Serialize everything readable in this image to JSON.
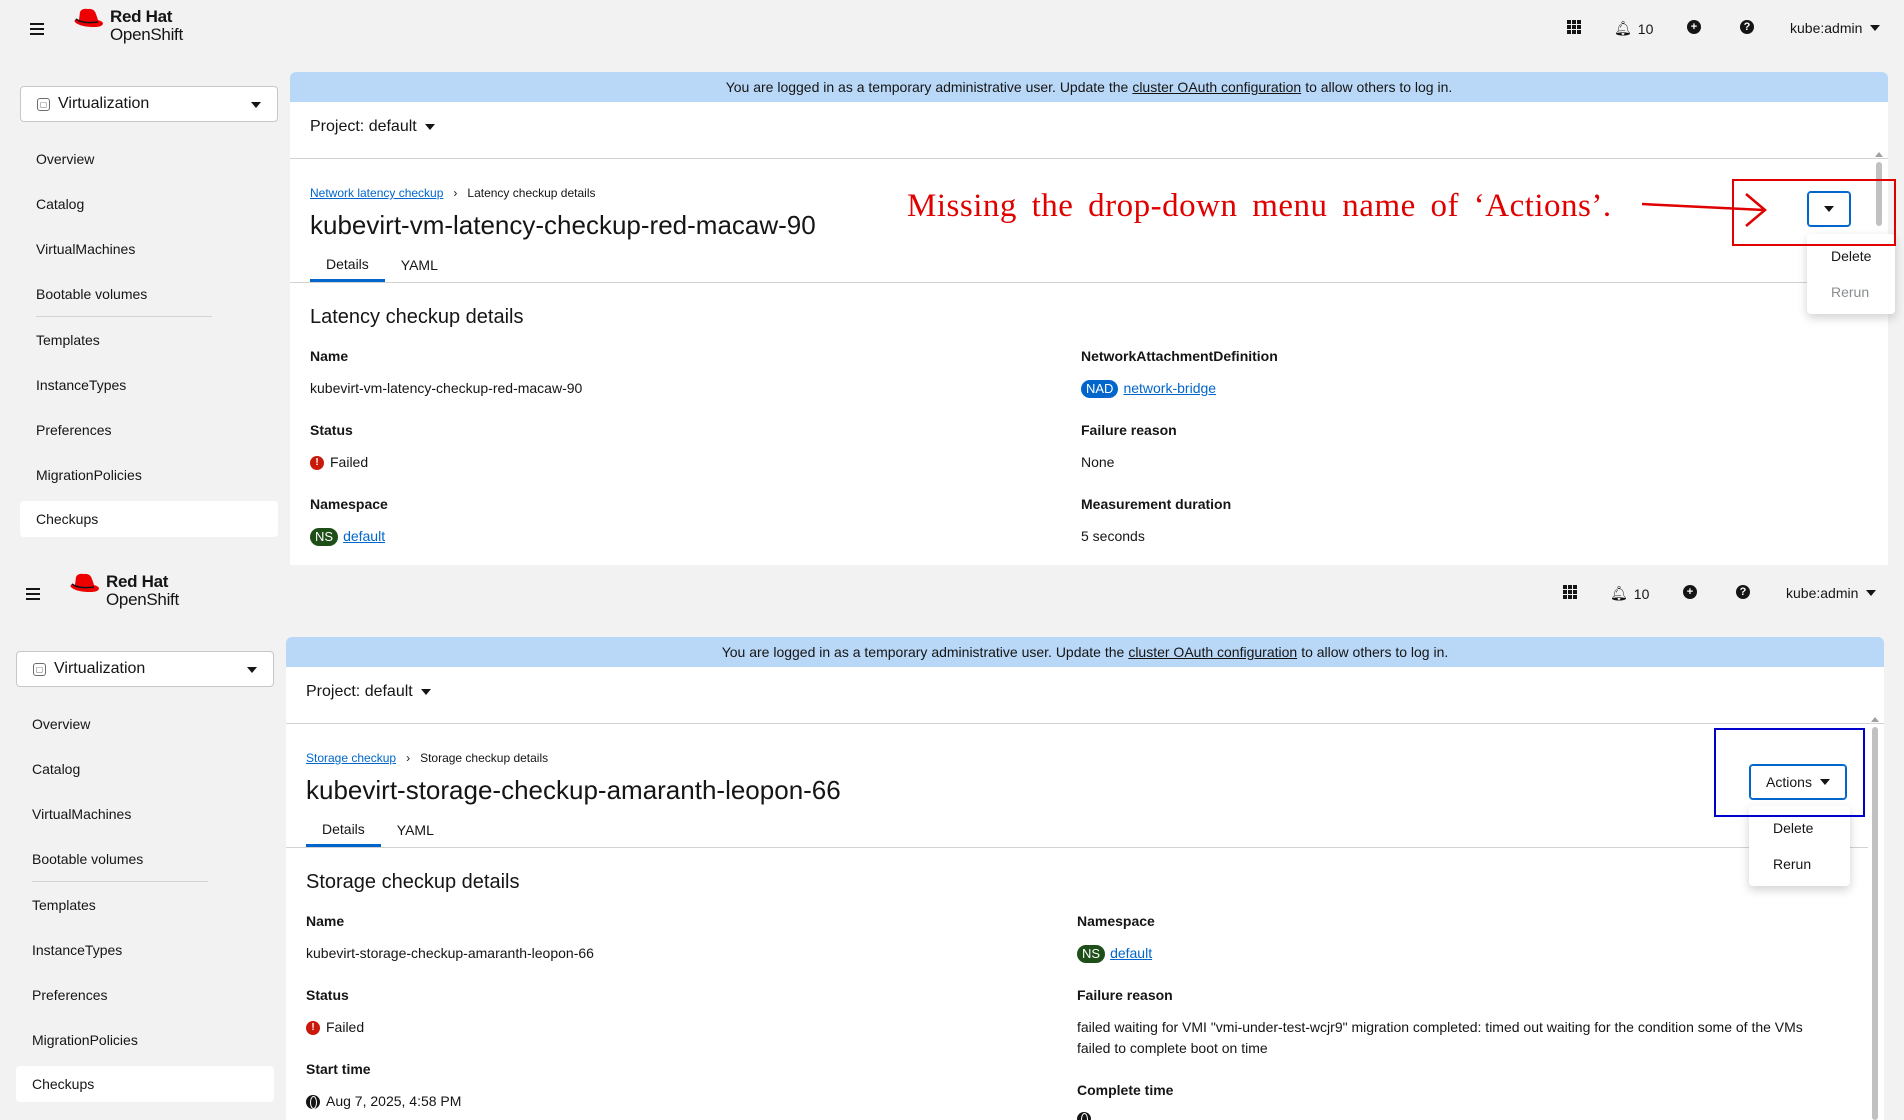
{
  "masthead": {
    "brand_line1": "Red Hat",
    "brand_line2": "OpenShift",
    "notifications_count": "10",
    "add_symbol": "+",
    "help_symbol": "?",
    "user": "kube:admin"
  },
  "sidebar": {
    "perspective": "Virtualization",
    "items": [
      "Overview",
      "Catalog",
      "VirtualMachines",
      "Bootable volumes",
      "Templates",
      "InstanceTypes",
      "Preferences",
      "MigrationPolicies",
      "Checkups"
    ]
  },
  "banner": {
    "prefix": "You are logged in as a temporary administrative user. Update the",
    "link": "cluster OAuth configuration",
    "suffix": "to allow others to log in."
  },
  "project_label": "Project: default",
  "tabs": [
    "Details",
    "YAML"
  ],
  "top_panel": {
    "breadcrumb_link": "Network latency checkup",
    "breadcrumb_current": "Latency checkup details",
    "title": "kubevirt-vm-latency-checkup-red-macaw-90",
    "section_title": "Latency checkup details",
    "fields": {
      "name_label": "Name",
      "name_value": "kubevirt-vm-latency-checkup-red-macaw-90",
      "status_label": "Status",
      "status_value": "Failed",
      "namespace_label": "Namespace",
      "namespace_badge": "NS",
      "namespace_value": "default",
      "nad_label": "NetworkAttachmentDefinition",
      "nad_badge": "NAD",
      "nad_value": "network-bridge",
      "failure_label": "Failure reason",
      "failure_value": "None",
      "duration_label": "Measurement duration",
      "duration_value": "5 seconds"
    },
    "menu": [
      {
        "label": "Delete",
        "disabled": false
      },
      {
        "label": "Rerun",
        "disabled": true
      }
    ],
    "annotation": "Missing the drop-down menu name of ‘Actions’."
  },
  "bottom_panel": {
    "breadcrumb_link": "Storage checkup",
    "breadcrumb_current": "Storage checkup details",
    "title": "kubevirt-storage-checkup-amaranth-leopon-66",
    "section_title": "Storage checkup details",
    "actions_label": "Actions",
    "fields": {
      "name_label": "Name",
      "name_value": "kubevirt-storage-checkup-amaranth-leopon-66",
      "status_label": "Status",
      "status_value": "Failed",
      "start_label": "Start time",
      "start_value": "Aug 7, 2025, 4:58 PM",
      "namespace_label": "Namespace",
      "namespace_badge": "NS",
      "namespace_value": "default",
      "failure_label": "Failure reason",
      "failure_line1": "failed waiting for VMI \"vmi-under-test-wcjr9\" migration completed: timed out waiting for the condition some of the VMs",
      "failure_line2": "failed to complete boot on time",
      "complete_label": "Complete time"
    },
    "menu": [
      {
        "label": "Delete",
        "disabled": false
      },
      {
        "label": "Rerun",
        "disabled": false
      }
    ]
  },
  "colors": {
    "brand_red": "#ee0000",
    "link": "#0066cc",
    "banner": "#b9d8f7",
    "annotation_red": "#e00000",
    "annotation_blue": "#0000cc"
  }
}
